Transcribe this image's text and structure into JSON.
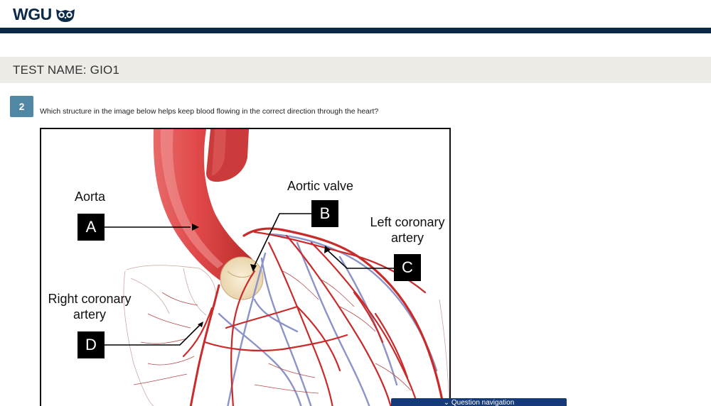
{
  "header": {
    "logo_text": "WGU",
    "logo_icon": "owl-icon"
  },
  "test": {
    "label": "TEST NAME:",
    "name": "GIO1"
  },
  "question": {
    "number": "2",
    "text": "Which structure in the image below helps keep blood flowing in the correct direction through the heart?"
  },
  "figure": {
    "labels": {
      "aorta": "Aorta",
      "aortic_valve": "Aortic valve",
      "left_coronary_1": "Left coronary",
      "left_coronary_2": "artery",
      "right_coronary_1": "Right coronary",
      "right_coronary_2": "artery"
    },
    "markers": {
      "a": "A",
      "b": "B",
      "c": "C",
      "d": "D"
    }
  },
  "footer": {
    "question_nav": "⌄ Question navigation"
  },
  "colors": {
    "brand_navy": "#0c2849",
    "question_badge": "#4f87a4",
    "nav_button": "#143a7a",
    "artery_red": "#c92a2a",
    "vein_blue": "#8c93c9"
  }
}
